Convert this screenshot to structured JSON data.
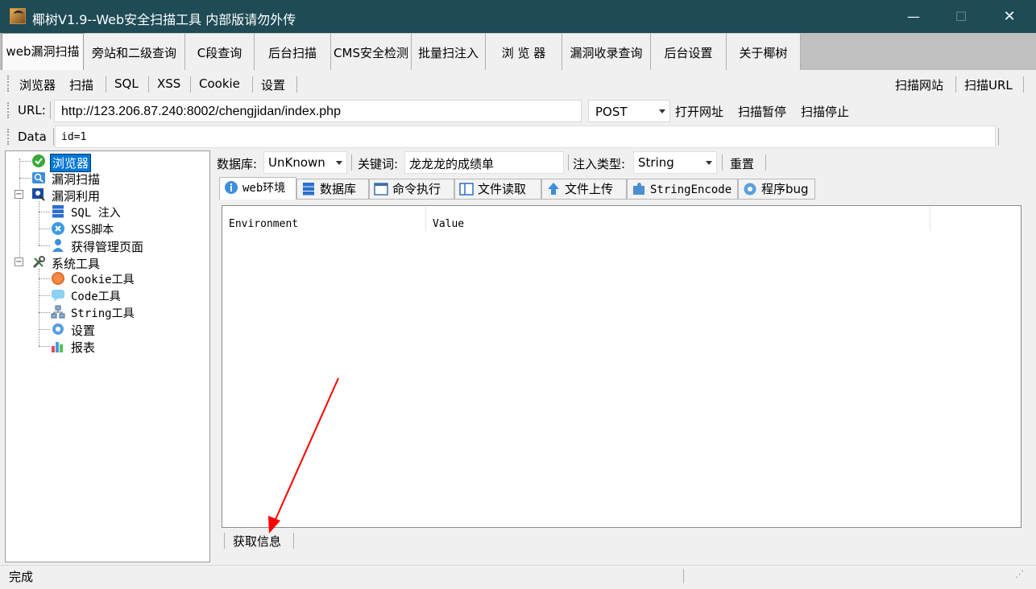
{
  "window": {
    "title": "椰树V1.9--Web安全扫描工具  内部版请勿外传",
    "minimize": "—",
    "maximize": "☐",
    "close": "✕"
  },
  "main_tabs": [
    {
      "label": "web漏洞扫描",
      "active": true
    },
    {
      "label": "旁站和二级查询"
    },
    {
      "label": "C段查询"
    },
    {
      "label": "后台扫描"
    },
    {
      "label": "CMS安全检测"
    },
    {
      "label": "批量扫注入"
    },
    {
      "label": "浏 览 器"
    },
    {
      "label": "漏洞收录查询"
    },
    {
      "label": "后台设置"
    },
    {
      "label": "关于椰树"
    }
  ],
  "toolbar1": {
    "items": [
      "浏览器",
      "扫描",
      "SQL",
      "XSS",
      "Cookie",
      "设置"
    ],
    "right_items": [
      "扫描网站",
      "扫描URL"
    ]
  },
  "toolbar2": {
    "url_label": "URL:",
    "url_value": "http://123.206.87.240:8002/chengjidan/index.php",
    "method": "POST",
    "open_url": "打开网址",
    "pause_scan": "扫描暂停",
    "stop_scan": "扫描停止"
  },
  "toolbar3": {
    "data_label": "Data",
    "data_value": "id=1"
  },
  "tree": {
    "browser": "浏览器",
    "vuln_scan": "漏洞扫描",
    "vuln_exploit": "漏洞利用",
    "sql_inject": "SQL 注入",
    "xss_script": "XSS脚本",
    "get_admin_page": "获得管理页面",
    "system_tools": "系统工具",
    "cookie_tool": "Cookie工具",
    "code_tool": "Code工具",
    "string_tool": "String工具",
    "settings": "设置",
    "report": "报表"
  },
  "inject_bar": {
    "db_label": "数据库:",
    "db_value": "UnKnown",
    "keyword_label": "关键词:",
    "keyword_value": "龙龙龙的成绩单",
    "type_label": "注入类型:",
    "type_value": "String",
    "reset": "重置"
  },
  "sub_tabs": [
    {
      "label": "web环境",
      "icon": "info-icon",
      "active": true
    },
    {
      "label": "数据库",
      "icon": "database-icon"
    },
    {
      "label": "命令执行",
      "icon": "window-icon"
    },
    {
      "label": "文件读取",
      "icon": "file-read-icon"
    },
    {
      "label": "文件上传",
      "icon": "upload-icon"
    },
    {
      "label": "StringEncode",
      "icon": "puzzle-icon"
    },
    {
      "label": "程序bug",
      "icon": "gear-icon"
    }
  ],
  "list_view": {
    "columns": [
      "Environment",
      "Value"
    ]
  },
  "bottom_toolbar": {
    "get_info": "获取信息"
  },
  "status": {
    "text": "完成"
  },
  "colors": {
    "title_bar": "#1e4b56",
    "selection": "#0078d7",
    "annotation_arrow": "#ff0000"
  }
}
